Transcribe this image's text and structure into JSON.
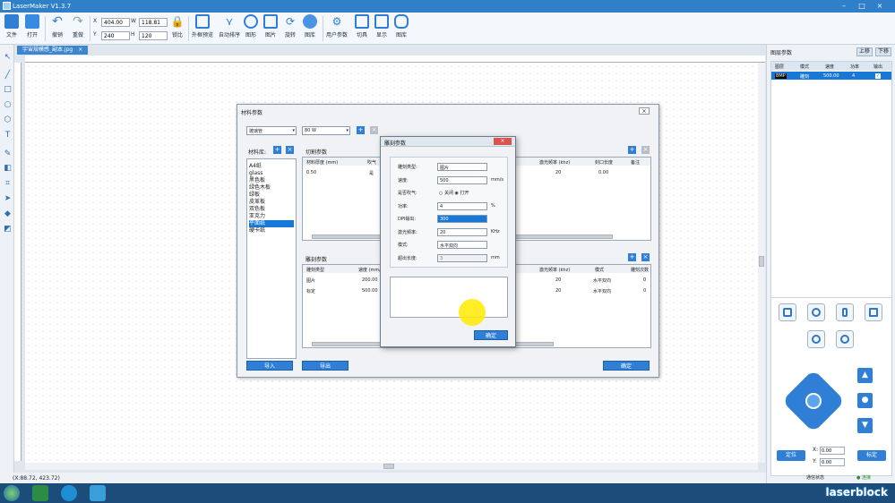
{
  "window": {
    "title": "LaserMaker V1.3.7"
  },
  "toolbar": {
    "file": "文件",
    "open": "打开",
    "undo": "撤销",
    "redo": "重做",
    "x_label": "X",
    "x_value": "404.00",
    "y_label": "Y",
    "y_value": "240",
    "w_label": "W",
    "w_value": "118.81",
    "h_label": "H",
    "h_value": "120",
    "lock": "锁比",
    "scan": "外框预览",
    "auto_sort": "自动排序",
    "shape": "图形",
    "image": "图片",
    "rotate": "旋转",
    "library": "图库",
    "user_params": "用户参数",
    "align": "切具",
    "preview": "显示",
    "gallery": "图库"
  },
  "doc_tab": {
    "label": "宇宙规模感_副本.jpg",
    "close": "×"
  },
  "status": {
    "coords": "(X:88.72, 423.72)"
  },
  "right_panel": {
    "title": "图层参数",
    "up": "上移",
    "down": "下移",
    "columns": [
      "图层",
      "模式",
      "速度",
      "功率",
      "输出"
    ],
    "row": [
      "BMP",
      "雕刻",
      "500.00",
      "4",
      "✓"
    ],
    "go_label": "定位",
    "set_label": "标定",
    "x_label": "X:",
    "x_value": "0.00",
    "y_label": "Y:",
    "y_value": "0.00",
    "conn_label": "通信状态",
    "conn_value": "● 连接"
  },
  "material_dialog": {
    "title": "材料参数",
    "close": "×",
    "material_select": "玻璃管",
    "power_select": "80 W",
    "material_label": "材料库:",
    "materials": [
      "A4纸",
      "glass",
      "黑色板",
      "绿色木板",
      "绿板",
      "皮革板",
      "双色板",
      "亚克力",
      "平面纸",
      "硬卡纸"
    ],
    "selected_material": 8,
    "cut_title": "切割参数",
    "cut_columns": [
      "材料厚度 (mm)",
      "吹气",
      "激光频率 (khz)",
      "封口长度",
      "备注"
    ],
    "cut_row": [
      "0.50",
      "是",
      "20",
      "0.00"
    ],
    "engrave_title": "雕刻参数",
    "engrave_columns": [
      "雕刻类型",
      "速度 (mm/s)",
      "激光频率 (khz)",
      "模式",
      "雕刻次数"
    ],
    "engrave_rows": [
      [
        "图片",
        "200.00",
        "20",
        "水平双向",
        "0"
      ],
      [
        "标定",
        "500.00",
        "20",
        "水平双向",
        "0"
      ]
    ],
    "import": "导入",
    "export": "导出",
    "confirm": "确定"
  },
  "engrave_dialog": {
    "title": "雕刻参数",
    "close": "×",
    "fields": [
      {
        "label": "雕刻类型:",
        "value": "图片",
        "unit": ""
      },
      {
        "label": "速度:",
        "value": "500",
        "unit": "mm/s"
      },
      {
        "label": "是否吹气:",
        "value": "○ 关闭   ◉ 打开",
        "unit": ""
      },
      {
        "label": "功率:",
        "value": "4",
        "unit": "%"
      },
      {
        "label": "DPI输出:",
        "value": "300",
        "unit": ""
      },
      {
        "label": "激光频率:",
        "value": "20",
        "unit": "KHz"
      },
      {
        "label": "模式:",
        "value": "水平双向",
        "unit": ""
      },
      {
        "label": "超出长度:",
        "value": "3",
        "unit": "mm"
      }
    ],
    "ok": "确定"
  },
  "branding": {
    "watermark": "laserblock"
  }
}
